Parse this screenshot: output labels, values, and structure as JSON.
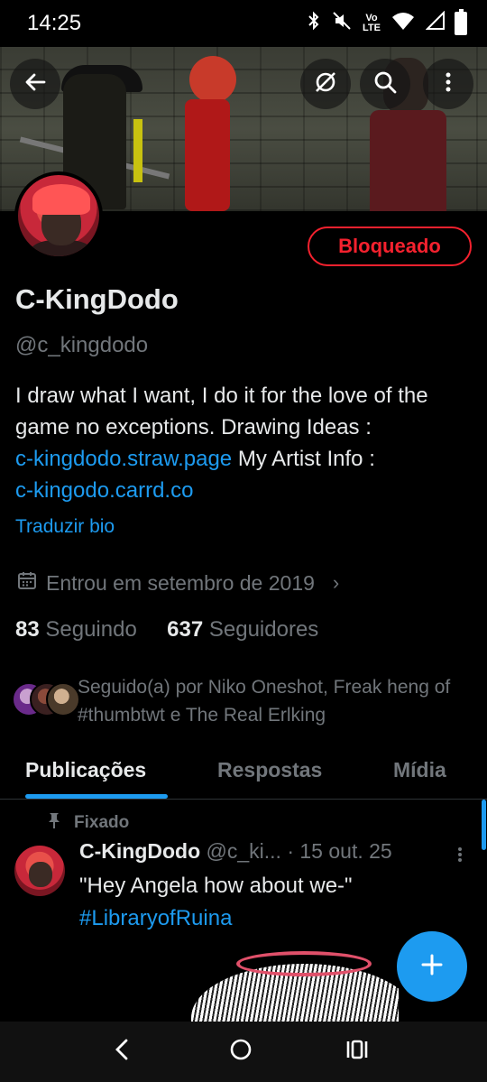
{
  "status_bar": {
    "time": "14:25",
    "lte_top": "Vo",
    "lte_bottom": "LTE"
  },
  "profile": {
    "button_blocked": "Bloqueado",
    "name": "C-KingDodo",
    "handle": "@c_kingdodo",
    "bio_text_1": "I draw what I want, I do it for the love of the game no exceptions. Drawing Ideas :",
    "bio_link_1": "c-kingdodo.straw.page",
    "bio_text_2": "My Artist Info :",
    "bio_link_2": "c-kingodo.carrd.co",
    "translate_bio": "Traduzir bio",
    "joined": "Entrou em setembro de 2019",
    "following_count": "83",
    "following_label": "Seguindo",
    "followers_count": "637",
    "followers_label": "Seguidores",
    "followed_by": "Seguido(a) por Niko Oneshot, Freak heng of #thumbtwt e The Real Erlking"
  },
  "tabs": [
    {
      "label": "Publicações",
      "active": true
    },
    {
      "label": "Respostas",
      "active": false
    },
    {
      "label": "Mídia",
      "active": false
    }
  ],
  "pinned_tweet": {
    "pinned_label": "Fixado",
    "author_name": "C-KingDodo",
    "author_handle": "@c_ki...",
    "date": "· 15 out. 25",
    "text": "\"Hey Angela how about we-\"",
    "hashtag": "#LibraryofRuina"
  },
  "icons": {
    "back": "arrow-left-icon",
    "unfollow": "no-sync-icon",
    "search": "search-icon",
    "more": "more-vertical-icon",
    "calendar": "calendar-icon",
    "pin": "pin-icon",
    "compose": "plus-icon"
  },
  "colors": {
    "accent": "#1d9bf0",
    "blocked": "#f4212e",
    "background": "#000000",
    "muted": "#71767b"
  }
}
